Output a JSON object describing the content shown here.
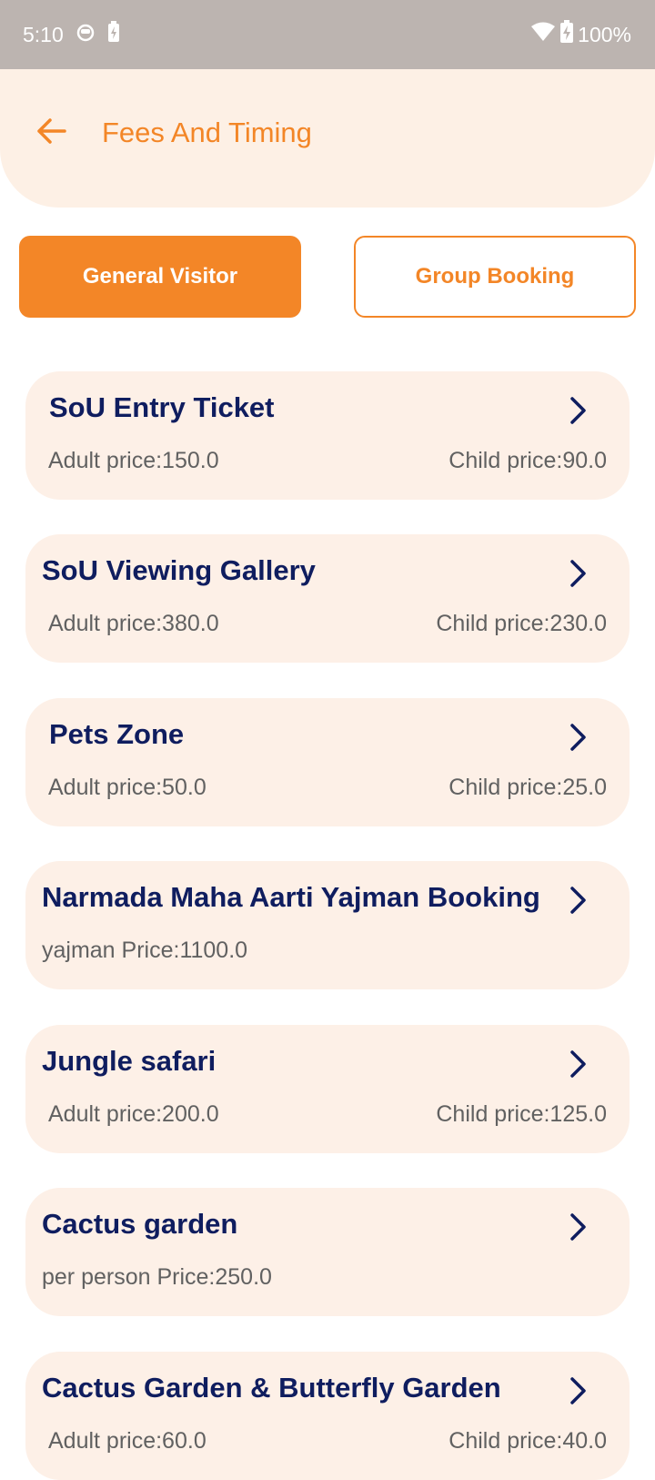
{
  "status_bar": {
    "time": "5:10",
    "battery_percent": "100%",
    "left_icons": [
      "cat-face-icon",
      "battery-charging-icon"
    ],
    "right_icons": [
      "wifi-icon",
      "battery-charging-icon"
    ]
  },
  "header": {
    "title": "Fees And Timing",
    "back_icon": "arrow-left-icon"
  },
  "tabs": [
    {
      "label": "General Visitor",
      "selected": true
    },
    {
      "label": "Group Booking",
      "selected": false
    }
  ],
  "colors": {
    "accent": "#f38627",
    "title_navy": "#0f1d5f",
    "card_bg": "#fdf0e7",
    "status_bar": "#bcb4b0"
  },
  "items": [
    {
      "title": "SoU Entry Ticket",
      "left": "Adult price:150.0",
      "right": "Child price:90.0"
    },
    {
      "title": "SoU Viewing Gallery",
      "left": "Adult price:380.0",
      "right": "Child price:230.0"
    },
    {
      "title": "Pets Zone",
      "left": "Adult price:50.0",
      "right": "Child price:25.0"
    },
    {
      "title": "Narmada Maha Aarti Yajman Booking",
      "left": "yajman Price:1100.0",
      "right": ""
    },
    {
      "title": "Jungle safari",
      "left": "Adult price:200.0",
      "right": "Child price:125.0"
    },
    {
      "title": "Cactus garden",
      "left": "per person Price:250.0",
      "right": ""
    },
    {
      "title": "Cactus Garden & Butterfly Garden",
      "left": "Adult price:60.0",
      "right": "Child price:40.0"
    }
  ]
}
